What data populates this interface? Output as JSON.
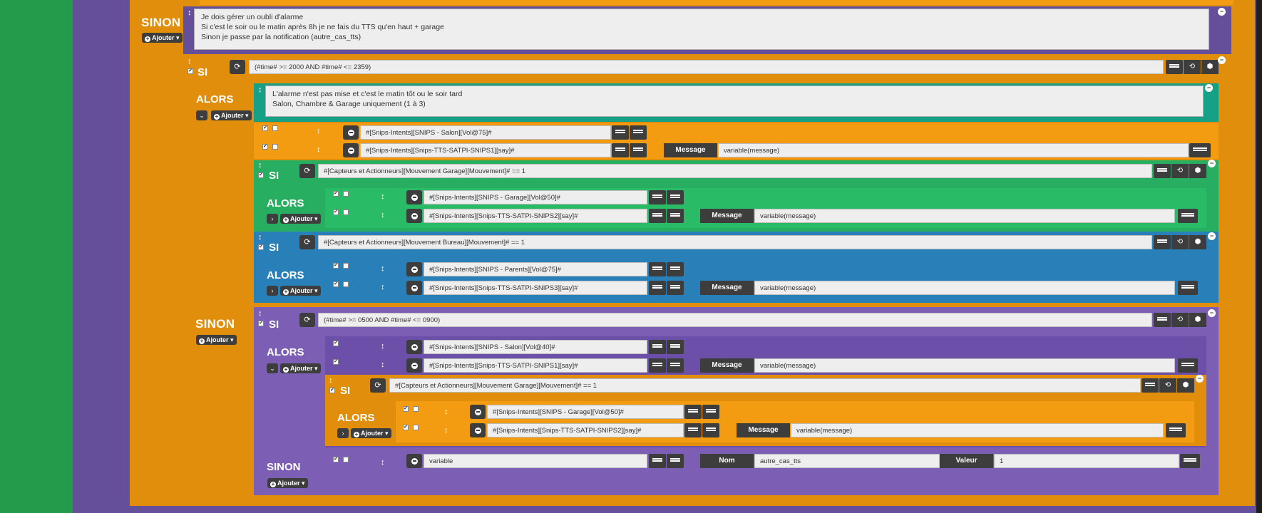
{
  "keywords": {
    "si": "SI",
    "alors": "ALORS",
    "sinon": "SINON",
    "ajouter": "Ajouter"
  },
  "icons": {
    "drag": "↕",
    "refresh": "⟳",
    "history": "⟲",
    "cube": "⬢",
    "chevron_down": "⌄",
    "chevron_right": "›",
    "check": "✔",
    "plus": "+"
  },
  "comment1": {
    "text": "Je dois gérer un oubli d'alarme\nSi c'est le soir ou le matin après 8h je ne fais du TTS qu'en haut + garage\nSinon je passe par la notification (autre_cas_tts)"
  },
  "si1": {
    "condition": "(#time# >= 2000 AND #time# <= 2359)"
  },
  "comment2": {
    "text": "L'alarme n'est pas mise et c'est le matin tôt ou le soir tard\nSalon, Chambre & Garage uniquement (1 à 3)"
  },
  "alors1": {
    "row1": {
      "cmd": "#[Snips-Intents][SNIPS - Salon][Vol@75]#"
    },
    "row2": {
      "cmd": "#[Snips-Intents][Snips-TTS-SATPI-SNIPS1][say]#",
      "label": "Message",
      "value": "variable(message)"
    }
  },
  "si_garage": {
    "condition": "#[Capteurs et Actionneurs][Mouvement Garage][Mouvement]# == 1",
    "row1": {
      "cmd": "#[Snips-Intents][SNIPS - Garage][Vol@50]#"
    },
    "row2": {
      "cmd": "#[Snips-Intents][Snips-TTS-SATPI-SNIPS2][say]#",
      "label": "Message",
      "value": "variable(message)"
    }
  },
  "si_bureau": {
    "condition": "#[Capteurs et Actionneurs][Mouvement Bureau][Mouvement]# == 1",
    "row1": {
      "cmd": "#[Snips-Intents][SNIPS - Parents][Vol@75]#"
    },
    "row2": {
      "cmd": "#[Snips-Intents][Snips-TTS-SATPI-SNIPS3][say]#",
      "label": "Message",
      "value": "variable(message)"
    }
  },
  "si_matin": {
    "condition": "(#time# >= 0500 AND #time# <= 0900)",
    "row1": {
      "cmd": "#[Snips-Intents][SNIPS - Salon][Vol@40]#"
    },
    "row2": {
      "cmd": "#[Snips-Intents][Snips-TTS-SATPI-SNIPS1][say]#",
      "label": "Message",
      "value": "variable(message)"
    }
  },
  "si_garage2": {
    "condition": "#[Capteurs et Actionneurs][Mouvement Garage][Mouvement]# == 1",
    "row1": {
      "cmd": "#[Snips-Intents][SNIPS - Garage][Vol@50]#"
    },
    "row2": {
      "cmd": "#[Snips-Intents][Snips-TTS-SATPI-SNIPS2][say]#",
      "label": "Message",
      "value": "variable(message)"
    }
  },
  "sinon_final": {
    "cmd": "variable",
    "nom_label": "Nom",
    "nom_value": "autre_cas_tts",
    "valeur_label": "Valeur",
    "valeur_value": "1"
  }
}
